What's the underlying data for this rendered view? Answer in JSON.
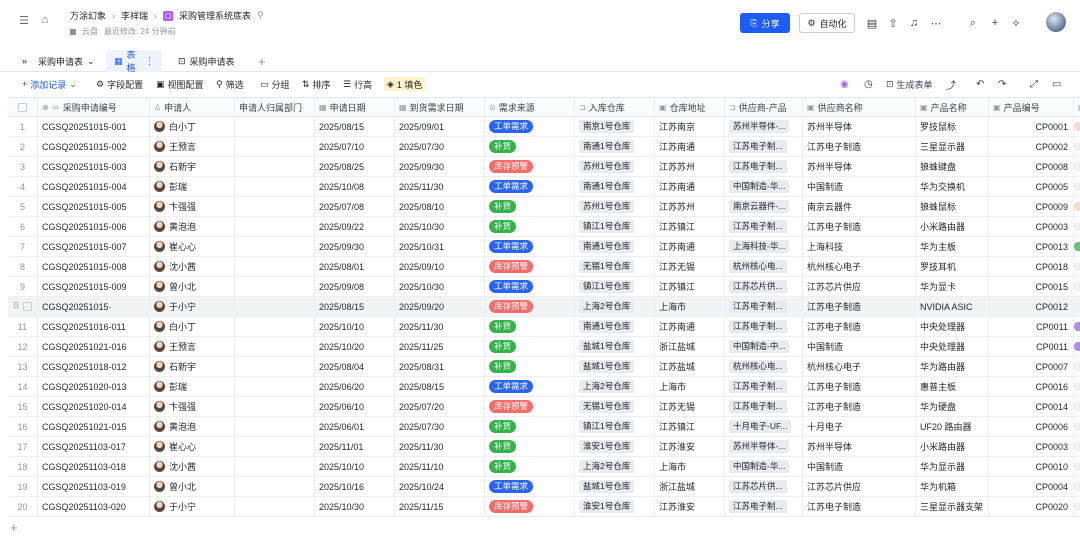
{
  "header": {
    "breadcrumb": [
      "万涂幻象",
      "李祥瑞",
      "采购管理系统底表"
    ],
    "doc_badge": "▢",
    "location": "云盘",
    "last_modified": "最近修改: 24 分钟前",
    "share_label": "分享",
    "automation_label": "自动化"
  },
  "tabs": [
    "采购申请表",
    "表格",
    "采购申请表"
  ],
  "toolbar": {
    "add_record": "添加记录",
    "field_config": "字段配置",
    "view_config": "视图配置",
    "filter": "筛选",
    "group": "分组",
    "sort": "排序",
    "row_height": "行高",
    "fill_color": "1 填色",
    "generate_form": "生成表单"
  },
  "columns": [
    "采购申请编号",
    "申请人",
    "申请人归属部门",
    "申请日期",
    "到货需求日期",
    "需求来源",
    "入库仓库",
    "仓库地址",
    "供应商-产品",
    "供应商名称",
    "产品名称",
    "产品编号"
  ],
  "rows": [
    {
      "n": "1",
      "id": "CGSQ20251015-001",
      "person": "白小丁",
      "date": "2025/08/15",
      "due": "2025/09/01",
      "src": "工单需求",
      "wh": "南京1号仓库",
      "addr": "江苏南京",
      "sp": "苏州半导体-...",
      "sup": "苏州半导体",
      "prod": "罗技鼠标",
      "code": "CP0001"
    },
    {
      "n": "2",
      "id": "CGSQ20251015-002",
      "person": "王预言",
      "date": "2025/07/10",
      "due": "2025/07/30",
      "src": "补货",
      "wh": "南通1号仓库",
      "addr": "江苏南通",
      "sp": "江苏电子制...",
      "sup": "江苏电子制造",
      "prod": "三星显示器",
      "code": "CP0002"
    },
    {
      "n": "3",
      "id": "CGSQ20251015-003",
      "person": "石新宇",
      "date": "2025/08/25",
      "due": "2025/09/30",
      "src": "库存预警",
      "wh": "苏州1号仓库",
      "addr": "江苏苏州",
      "sp": "江苏电子制...",
      "sup": "苏州半导体",
      "prod": "狼蛛键盘",
      "code": "CP0008"
    },
    {
      "n": "4",
      "id": "CGSQ20251015-004",
      "person": "彭瑞",
      "date": "2025/10/08",
      "due": "2025/11/30",
      "src": "工单需求",
      "wh": "南通1号仓库",
      "addr": "江苏南通",
      "sp": "中国制造-华...",
      "sup": "中国制造",
      "prod": "华为交换机",
      "code": "CP0005"
    },
    {
      "n": "5",
      "id": "CGSQ20251015-005",
      "person": "卞强强",
      "date": "2025/07/08",
      "due": "2025/08/10",
      "src": "补货",
      "wh": "苏州1号仓库",
      "addr": "江苏苏州",
      "sp": "南京云器件-...",
      "sup": "南京云器件",
      "prod": "狼蛛鼠标",
      "code": "CP0009"
    },
    {
      "n": "6",
      "id": "CGSQ20251015-006",
      "person": "黄泡泡",
      "date": "2025/09/22",
      "due": "2025/10/30",
      "src": "补货",
      "wh": "镇江1号仓库",
      "addr": "江苏镇江",
      "sp": "江苏电子制...",
      "sup": "江苏电子制造",
      "prod": "小米路由器",
      "code": "CP0003"
    },
    {
      "n": "7",
      "id": "CGSQ20251015-007",
      "person": "崔心心",
      "date": "2025/09/30",
      "due": "2025/10/31",
      "src": "工单需求",
      "wh": "南通1号仓库",
      "addr": "江苏南通",
      "sp": "上海科技-华...",
      "sup": "上海科技",
      "prod": "华为主板",
      "code": "CP0013"
    },
    {
      "n": "8",
      "id": "CGSQ20251015-008",
      "person": "沈小茜",
      "date": "2025/08/01",
      "due": "2025/09/10",
      "src": "库存预警",
      "wh": "无锡1号仓库",
      "addr": "江苏无锡",
      "sp": "杭州核心电...",
      "sup": "杭州核心电子",
      "prod": "罗技耳机",
      "code": "CP0018"
    },
    {
      "n": "9",
      "id": "CGSQ20251015-009",
      "person": "曾小北",
      "date": "2025/09/08",
      "due": "2025/10/30",
      "src": "工单需求",
      "wh": "镇江1号仓库",
      "addr": "江苏镇江",
      "sp": "江苏芯片供...",
      "sup": "江苏芯片供应",
      "prod": "华为显卡",
      "code": "CP0015"
    },
    {
      "n": "",
      "id": "CGSQ20251015·",
      "person": "于小宁",
      "date": "2025/08/15",
      "due": "2025/09/20",
      "src": "库存预警",
      "wh": "上海2号仓库",
      "addr": "上海市",
      "sp": "江苏电子制...",
      "sup": "江苏电子制造",
      "prod": "NVIDIA ASIC",
      "code": "CP0012"
    },
    {
      "n": "11",
      "id": "CGSQ20251016-011",
      "person": "白小丁",
      "date": "2025/10/10",
      "due": "2025/11/30",
      "src": "补货",
      "wh": "南通1号仓库",
      "addr": "江苏南通",
      "sp": "江苏电子制...",
      "sup": "江苏电子制造",
      "prod": "中央处理器",
      "code": "CP0011"
    },
    {
      "n": "12",
      "id": "CGSQ20251021-016",
      "person": "王预言",
      "date": "2025/10/20",
      "due": "2025/11/25",
      "src": "补货",
      "wh": "盐城1号仓库",
      "addr": "浙江盐城",
      "sp": "中国制造-中...",
      "sup": "中国制造",
      "prod": "中央处理器",
      "code": "CP0011"
    },
    {
      "n": "13",
      "id": "CGSQ20251018-012",
      "person": "石新宇",
      "date": "2025/08/04",
      "due": "2025/08/31",
      "src": "补货",
      "wh": "盐城1号仓库",
      "addr": "江苏盐城",
      "sp": "杭州核心电...",
      "sup": "杭州核心电子",
      "prod": "华为路由器",
      "code": "CP0007"
    },
    {
      "n": "14",
      "id": "CGSQ20251020-013",
      "person": "彭瑞",
      "date": "2025/06/20",
      "due": "2025/08/15",
      "src": "工单需求",
      "wh": "上海2号仓库",
      "addr": "上海市",
      "sp": "江苏电子制...",
      "sup": "江苏电子制造",
      "prod": "惠普主板",
      "code": "CP0016"
    },
    {
      "n": "15",
      "id": "CGSQ20251020-014",
      "person": "卞强强",
      "date": "2025/06/10",
      "due": "2025/07/20",
      "src": "库存预警",
      "wh": "无锡1号仓库",
      "addr": "江苏无锡",
      "sp": "江苏电子制...",
      "sup": "江苏电子制造",
      "prod": "华为硬盘",
      "code": "CP0014"
    },
    {
      "n": "16",
      "id": "CGSQ20251021-015",
      "person": "黄泡泡",
      "date": "2025/06/01",
      "due": "2025/07/30",
      "src": "补货",
      "wh": "镇江1号仓库",
      "addr": "江苏镇江",
      "sp": "十月电子-UF...",
      "sup": "十月电子",
      "prod": "UF20 路由器",
      "code": "CP0006"
    },
    {
      "n": "17",
      "id": "CGSQ20251103-017",
      "person": "崔心心",
      "date": "2025/11/01",
      "due": "2025/11/30",
      "src": "补货",
      "wh": "淮安1号仓库",
      "addr": "江苏淮安",
      "sp": "苏州半导体-...",
      "sup": "苏州半导体",
      "prod": "小米路由器",
      "code": "CP0003"
    },
    {
      "n": "18",
      "id": "CGSQ20251103-018",
      "person": "沈小茜",
      "date": "2025/10/10",
      "due": "2025/11/10",
      "src": "补货",
      "wh": "上海2号仓库",
      "addr": "上海市",
      "sp": "中国制造-华...",
      "sup": "中国制造",
      "prod": "华为显示器",
      "code": "CP0010"
    },
    {
      "n": "19",
      "id": "CGSQ20251103-019",
      "person": "曾小北",
      "date": "2025/10/16",
      "due": "2025/10/24",
      "src": "工单需求",
      "wh": "盐城1号仓库",
      "addr": "浙江盐城",
      "sp": "江苏芯片供...",
      "sup": "江苏芯片供应",
      "prod": "华为机箱",
      "code": "CP0004"
    },
    {
      "n": "20",
      "id": "CGSQ20251103-020",
      "person": "于小宁",
      "date": "2025/10/30",
      "due": "2025/11/15",
      "src": "库存预警",
      "wh": "淮安1号仓库",
      "addr": "江苏淮安",
      "sp": "江苏电子制...",
      "sup": "江苏电子制造",
      "prod": "三星显示器支架",
      "code": "CP0020"
    }
  ],
  "source_colors": {
    "工单需求": "blue",
    "补货": "green",
    "库存预警": "red"
  },
  "edge_colors": [
    "#f4d9d9",
    "#eef0f3",
    "#eef0f3",
    "#eef0f3",
    "#f6dcc9",
    "#eef0f3",
    "#64c47a",
    "#eef0f3",
    "#eef0f3",
    "#eef0f3",
    "#b48ce8",
    "#b48ce8",
    "#eef0f3",
    "#eef0f3",
    "#eef0f3",
    "#eef0f3",
    "#eef0f3",
    "#eef0f3",
    "#eef0f3",
    "#eef0f3"
  ]
}
